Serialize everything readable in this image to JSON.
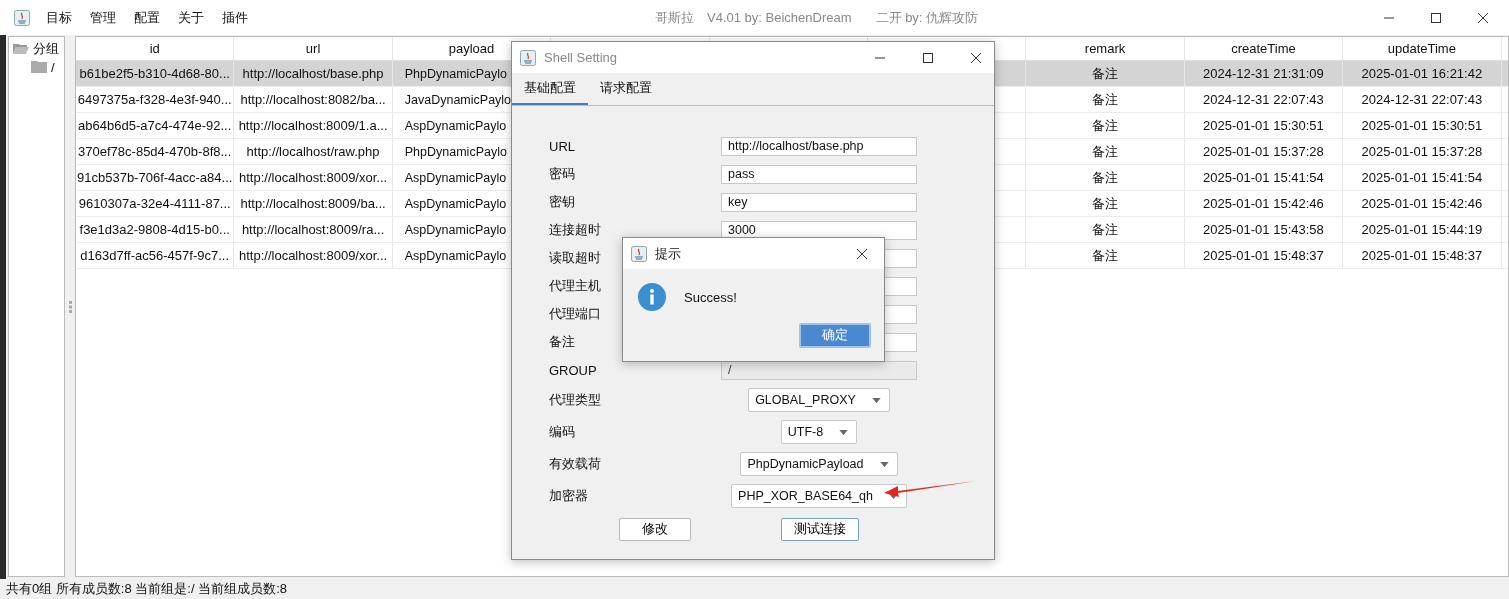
{
  "window": {
    "menu": [
      "目标",
      "管理",
      "配置",
      "关于",
      "插件"
    ],
    "title": "哥斯拉　V4.01 by: BeichenDream",
    "subtitle": "二开 by: 仇辉攻防"
  },
  "tree": {
    "label": "分组",
    "expanded": true,
    "children": [
      {
        "label": "/"
      }
    ]
  },
  "table": {
    "columns": [
      "id",
      "url",
      "payload",
      "remark",
      "createTime",
      "updateTime"
    ],
    "rows": [
      {
        "selected": true,
        "cells": [
          "b61be2f5-b310-4d68-80...",
          "http://localhost/base.php",
          "PhpDynamicPaylo",
          "备注",
          "2024-12-31 21:31:09",
          "2025-01-01 16:21:42"
        ]
      },
      {
        "selected": false,
        "cells": [
          "6497375a-f328-4e3f-940...",
          "http://localhost:8082/ba...",
          "JavaDynamicPaylo",
          "备注",
          "2024-12-31 22:07:43",
          "2024-12-31 22:07:43"
        ]
      },
      {
        "selected": false,
        "cells": [
          "ab64b6d5-a7c4-474e-92...",
          "http://localhost:8009/1.a...",
          "AspDynamicPaylo",
          "备注",
          "2025-01-01 15:30:51",
          "2025-01-01 15:30:51"
        ]
      },
      {
        "selected": false,
        "cells": [
          "370ef78c-85d4-470b-8f8...",
          "http://localhost/raw.php",
          "PhpDynamicPaylo",
          "备注",
          "2025-01-01 15:37:28",
          "2025-01-01 15:37:28"
        ]
      },
      {
        "selected": false,
        "cells": [
          "91cb537b-706f-4acc-a84...",
          "http://localhost:8009/xor...",
          "AspDynamicPaylo",
          "备注",
          "2025-01-01 15:41:54",
          "2025-01-01 15:41:54"
        ]
      },
      {
        "selected": false,
        "cells": [
          "9610307a-32e4-4111-87...",
          "http://localhost:8009/ba...",
          "AspDynamicPaylo",
          "备注",
          "2025-01-01 15:42:46",
          "2025-01-01 15:42:46"
        ]
      },
      {
        "selected": false,
        "cells": [
          "f3e1d3a2-9808-4d15-b0...",
          "http://localhost:8009/ra...",
          "AspDynamicPaylo",
          "备注",
          "2025-01-01 15:43:58",
          "2025-01-01 15:44:19"
        ]
      },
      {
        "selected": false,
        "cells": [
          "d163d7ff-ac56-457f-9c7...",
          "http://localhost:8009/xor...",
          "AspDynamicPaylo",
          "备注",
          "2025-01-01 15:48:37",
          "2025-01-01 15:48:37"
        ]
      }
    ]
  },
  "status_bar": "共有0组 所有成员数:8 当前组是:/ 当前组成员数:8",
  "shell_dialog": {
    "title": "Shell Setting",
    "tabs": [
      {
        "label": "基础配置",
        "selected": true
      },
      {
        "label": "请求配置",
        "selected": false
      }
    ],
    "fields": [
      {
        "kind": "text",
        "label": "URL",
        "value": "http://localhost/base.php",
        "disabled": false
      },
      {
        "kind": "text",
        "label": "密码",
        "value": "pass",
        "disabled": false
      },
      {
        "kind": "text",
        "label": "密钥",
        "value": "key",
        "disabled": false
      },
      {
        "kind": "text",
        "label": "连接超时",
        "value": "3000",
        "disabled": false
      },
      {
        "kind": "text",
        "label": "读取超时",
        "disabled": false
      },
      {
        "kind": "text",
        "label": "代理主机",
        "disabled": false
      },
      {
        "kind": "text",
        "label": "代理端口",
        "disabled": false
      },
      {
        "kind": "text",
        "label": "备注",
        "disabled": false
      },
      {
        "kind": "text",
        "label": "GROUP",
        "value": "/",
        "disabled": true
      },
      {
        "kind": "combo",
        "label": "代理类型",
        "value": "GLOBAL_PROXY"
      },
      {
        "kind": "combo",
        "label": "编码",
        "value": "UTF-8"
      },
      {
        "kind": "combo",
        "label": "有效载荷",
        "value": "PhpDynamicPayload"
      },
      {
        "kind": "combo",
        "label": "加密器",
        "value": "PHP_XOR_BASE64_qh"
      }
    ],
    "buttons": [
      "修改",
      "测试连接"
    ]
  },
  "message_dialog": {
    "title": "提示",
    "message": "Success!",
    "button": "确定"
  }
}
